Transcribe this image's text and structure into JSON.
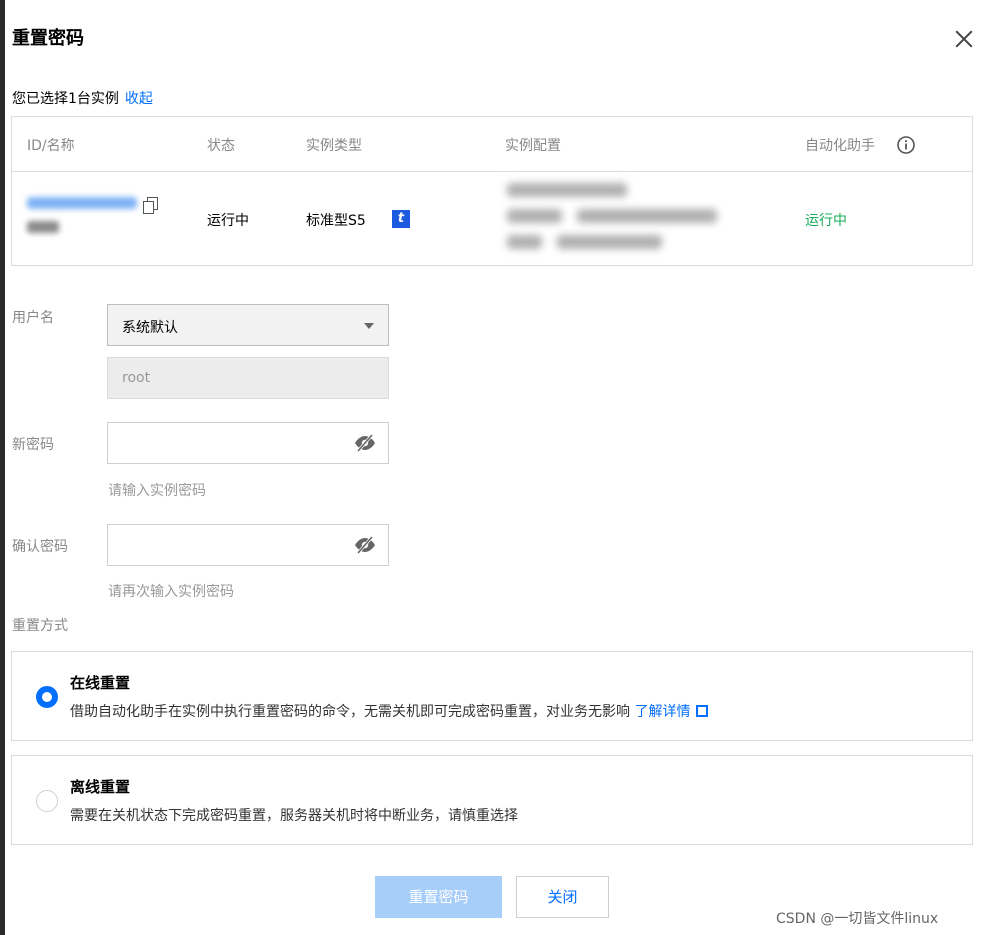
{
  "dialog": {
    "title": "重置密码",
    "selected_prefix": "您已选择1台实例",
    "collapse_link": "收起"
  },
  "table": {
    "headers": [
      "ID/名称",
      "状态",
      "实例类型",
      "实例配置",
      "自动化助手"
    ],
    "row": {
      "status": "运行中",
      "instance_type": "标准型S5",
      "type_badge": "t",
      "assistant_status": "运行中"
    }
  },
  "form": {
    "username_label": "用户名",
    "username_select_value": "系统默认",
    "username_value": "root",
    "new_password_label": "新密码",
    "new_password_hint": "请输入实例密码",
    "confirm_password_label": "确认密码",
    "confirm_password_hint": "请再次输入实例密码",
    "reset_mode_label": "重置方式"
  },
  "options": [
    {
      "title": "在线重置",
      "desc": "借助自动化助手在实例中执行重置密码的命令，无需关机即可完成密码重置，对业务无影响",
      "link": "了解详情",
      "selected": true
    },
    {
      "title": "离线重置",
      "desc": "需要在关机状态下完成密码重置，服务器关机时将中断业务，请慎重选择",
      "selected": false
    }
  ],
  "buttons": {
    "confirm": "重置密码",
    "close": "关闭"
  },
  "watermark": "CSDN @一切皆文件linux",
  "colors": {
    "accent": "#006eff",
    "running": "#1aad59",
    "primary_disabled": "#a7cdf9"
  }
}
